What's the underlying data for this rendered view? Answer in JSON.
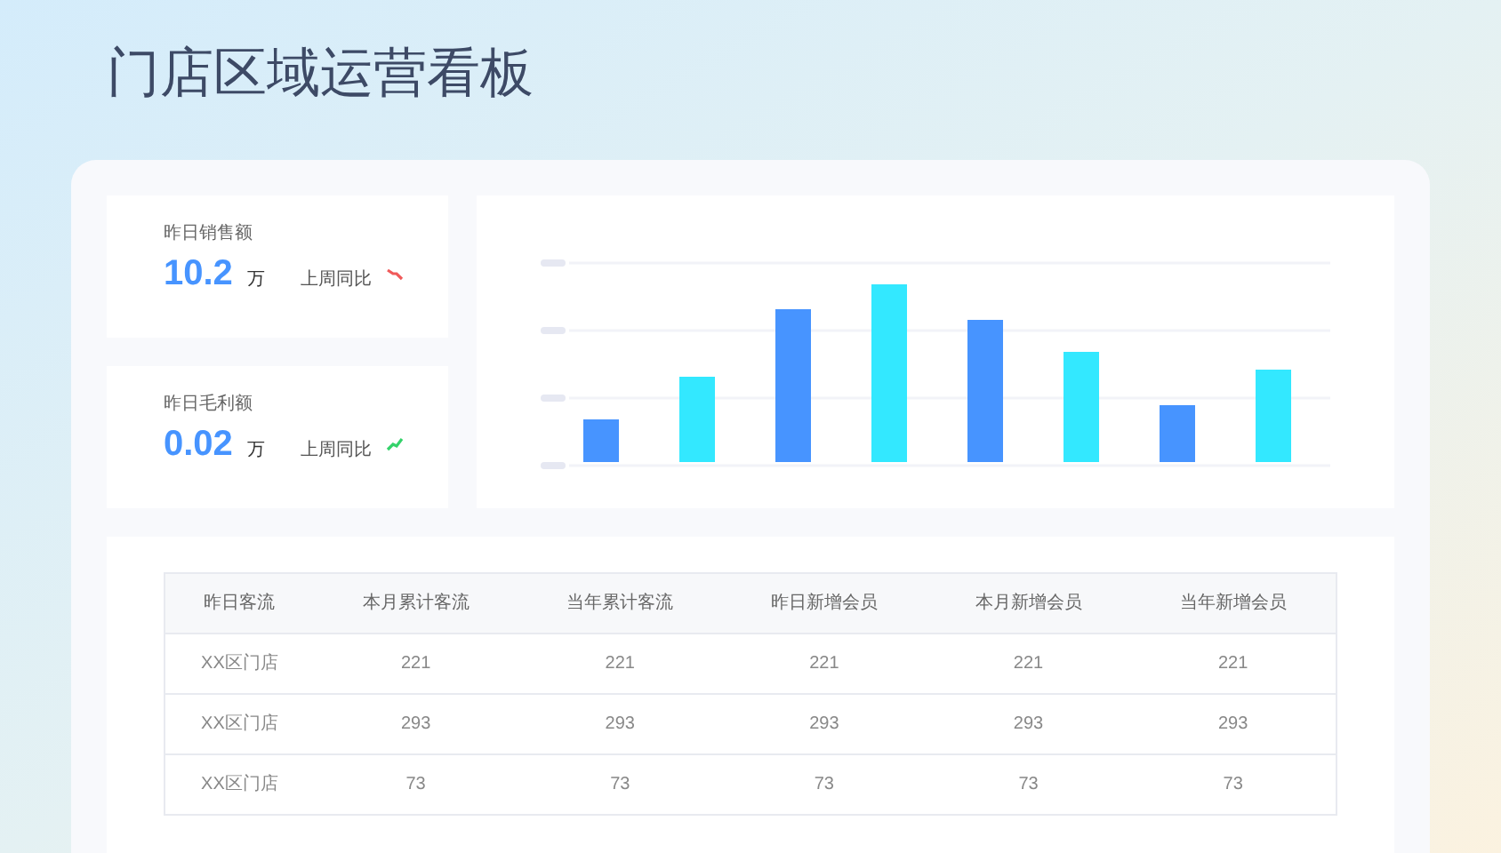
{
  "title": "门店区域运营看板",
  "kpis": [
    {
      "label": "昨日销售额",
      "value": "10.2",
      "unit": "万",
      "compare_label": "上周同比",
      "color": "#f05a5a"
    },
    {
      "label": "昨日毛利额",
      "value": "0.02",
      "unit": "万",
      "compare_label": "上周同比",
      "color": "#34d26a"
    }
  ],
  "table": {
    "columns": [
      "昨日客流",
      "本月累计客流",
      "当年累计客流",
      "昨日新增会员",
      "本月新增会员",
      "当年新增会员"
    ],
    "rows": [
      [
        "XX区门店",
        "221",
        "221",
        "221",
        "221",
        "221"
      ],
      [
        "XX区门店",
        "293",
        "293",
        "293",
        "293",
        "293"
      ],
      [
        "XX区门店",
        "73",
        "73",
        "73",
        "73",
        "73"
      ]
    ]
  }
}
